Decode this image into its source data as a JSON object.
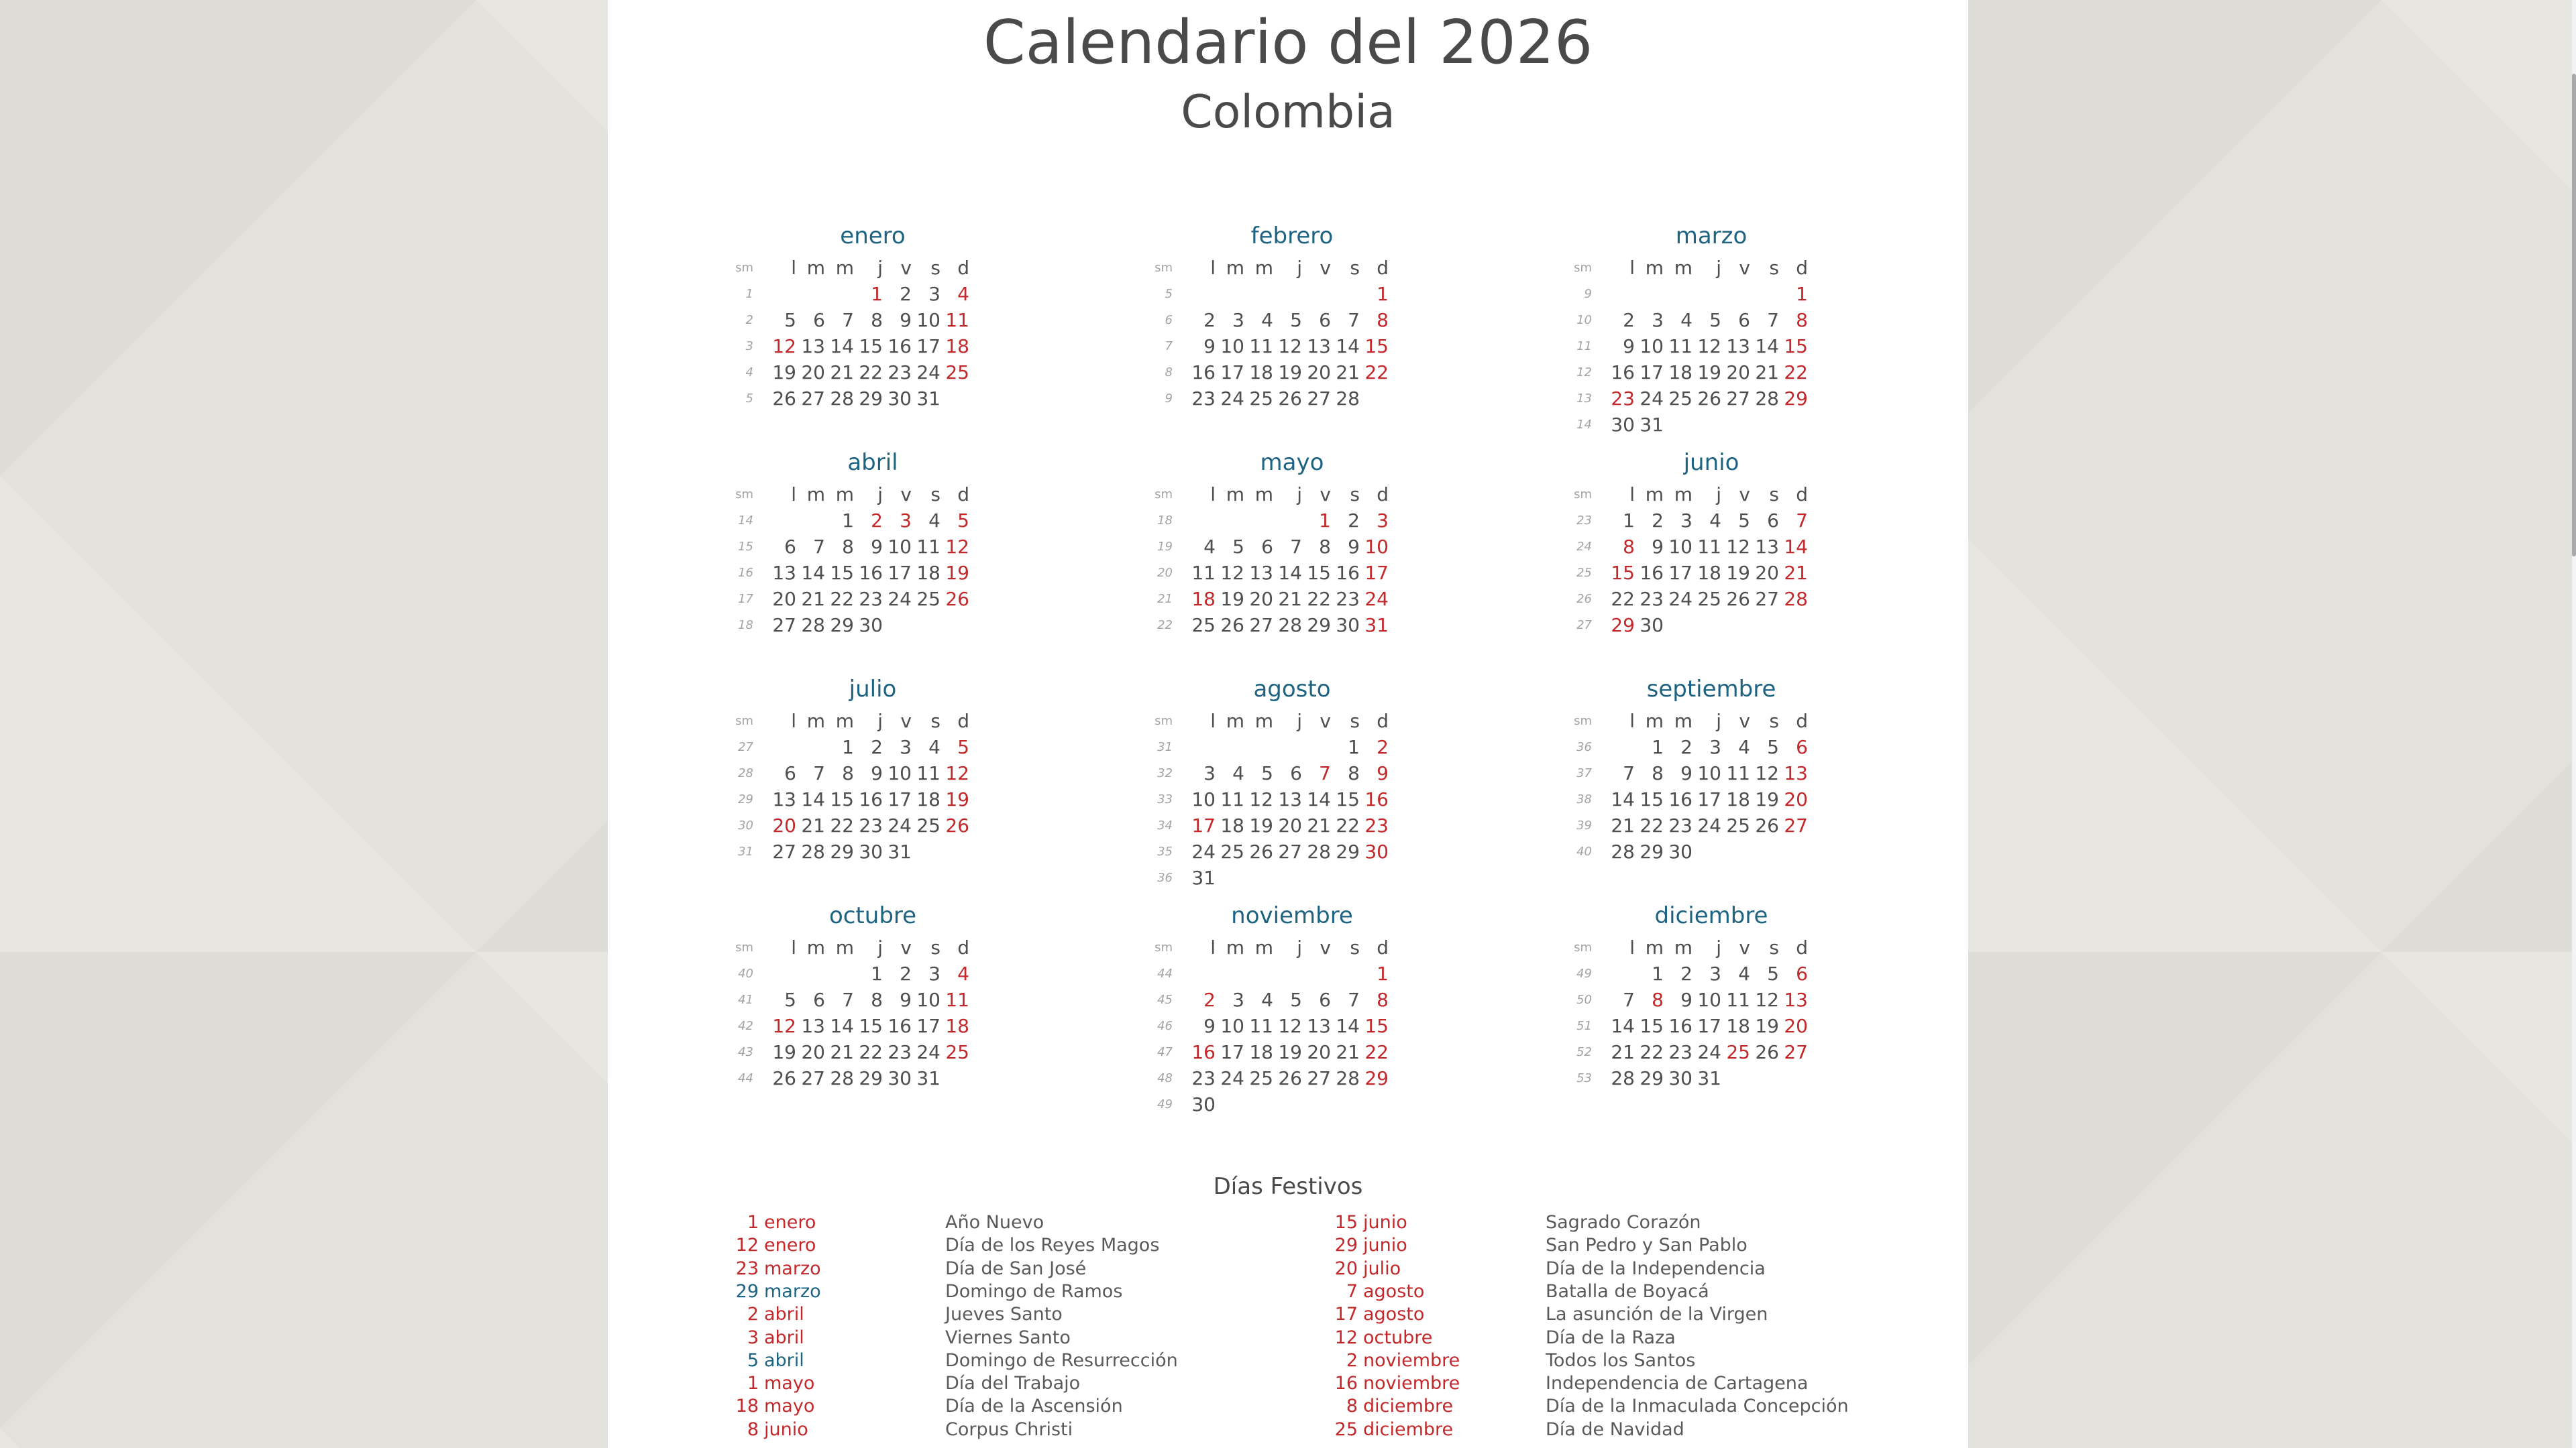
{
  "header": {
    "title": "Calendario del 2026",
    "subtitle": "Colombia"
  },
  "calendar": {
    "week_header": "sm",
    "weekday_headers": [
      "l",
      "m",
      "m",
      "j",
      "v",
      "s",
      "d"
    ],
    "months": [
      {
        "name": "enero",
        "weeks": [
          {
            "wk": "1",
            "days": [
              "",
              "",
              "",
              "1",
              "2",
              "3",
              "4"
            ]
          },
          {
            "wk": "2",
            "days": [
              "5",
              "6",
              "7",
              "8",
              "9",
              "10",
              "11"
            ]
          },
          {
            "wk": "3",
            "days": [
              "12",
              "13",
              "14",
              "15",
              "16",
              "17",
              "18"
            ]
          },
          {
            "wk": "4",
            "days": [
              "19",
              "20",
              "21",
              "22",
              "23",
              "24",
              "25"
            ]
          },
          {
            "wk": "5",
            "days": [
              "26",
              "27",
              "28",
              "29",
              "30",
              "31",
              ""
            ]
          }
        ],
        "holidays": [
          "1",
          "12"
        ]
      },
      {
        "name": "febrero",
        "weeks": [
          {
            "wk": "5",
            "days": [
              "",
              "",
              "",
              "",
              "",
              "",
              "1"
            ]
          },
          {
            "wk": "6",
            "days": [
              "2",
              "3",
              "4",
              "5",
              "6",
              "7",
              "8"
            ]
          },
          {
            "wk": "7",
            "days": [
              "9",
              "10",
              "11",
              "12",
              "13",
              "14",
              "15"
            ]
          },
          {
            "wk": "8",
            "days": [
              "16",
              "17",
              "18",
              "19",
              "20",
              "21",
              "22"
            ]
          },
          {
            "wk": "9",
            "days": [
              "23",
              "24",
              "25",
              "26",
              "27",
              "28",
              ""
            ]
          }
        ],
        "holidays": []
      },
      {
        "name": "marzo",
        "weeks": [
          {
            "wk": "9",
            "days": [
              "",
              "",
              "",
              "",
              "",
              "",
              "1"
            ]
          },
          {
            "wk": "10",
            "days": [
              "2",
              "3",
              "4",
              "5",
              "6",
              "7",
              "8"
            ]
          },
          {
            "wk": "11",
            "days": [
              "9",
              "10",
              "11",
              "12",
              "13",
              "14",
              "15"
            ]
          },
          {
            "wk": "12",
            "days": [
              "16",
              "17",
              "18",
              "19",
              "20",
              "21",
              "22"
            ]
          },
          {
            "wk": "13",
            "days": [
              "23",
              "24",
              "25",
              "26",
              "27",
              "28",
              "29"
            ]
          },
          {
            "wk": "14",
            "days": [
              "30",
              "31",
              "",
              "",
              "",
              "",
              ""
            ]
          }
        ],
        "holidays": [
          "23"
        ]
      },
      {
        "name": "abril",
        "weeks": [
          {
            "wk": "14",
            "days": [
              "",
              "",
              "1",
              "2",
              "3",
              "4",
              "5"
            ]
          },
          {
            "wk": "15",
            "days": [
              "6",
              "7",
              "8",
              "9",
              "10",
              "11",
              "12"
            ]
          },
          {
            "wk": "16",
            "days": [
              "13",
              "14",
              "15",
              "16",
              "17",
              "18",
              "19"
            ]
          },
          {
            "wk": "17",
            "days": [
              "20",
              "21",
              "22",
              "23",
              "24",
              "25",
              "26"
            ]
          },
          {
            "wk": "18",
            "days": [
              "27",
              "28",
              "29",
              "30",
              "",
              "",
              ""
            ]
          }
        ],
        "holidays": [
          "2",
          "3"
        ]
      },
      {
        "name": "mayo",
        "weeks": [
          {
            "wk": "18",
            "days": [
              "",
              "",
              "",
              "",
              "1",
              "2",
              "3"
            ]
          },
          {
            "wk": "19",
            "days": [
              "4",
              "5",
              "6",
              "7",
              "8",
              "9",
              "10"
            ]
          },
          {
            "wk": "20",
            "days": [
              "11",
              "12",
              "13",
              "14",
              "15",
              "16",
              "17"
            ]
          },
          {
            "wk": "21",
            "days": [
              "18",
              "19",
              "20",
              "21",
              "22",
              "23",
              "24"
            ]
          },
          {
            "wk": "22",
            "days": [
              "25",
              "26",
              "27",
              "28",
              "29",
              "30",
              "31"
            ]
          }
        ],
        "holidays": [
          "1",
          "18"
        ]
      },
      {
        "name": "junio",
        "weeks": [
          {
            "wk": "23",
            "days": [
              "1",
              "2",
              "3",
              "4",
              "5",
              "6",
              "7"
            ]
          },
          {
            "wk": "24",
            "days": [
              "8",
              "9",
              "10",
              "11",
              "12",
              "13",
              "14"
            ]
          },
          {
            "wk": "25",
            "days": [
              "15",
              "16",
              "17",
              "18",
              "19",
              "20",
              "21"
            ]
          },
          {
            "wk": "26",
            "days": [
              "22",
              "23",
              "24",
              "25",
              "26",
              "27",
              "28"
            ]
          },
          {
            "wk": "27",
            "days": [
              "29",
              "30",
              "",
              "",
              "",
              "",
              ""
            ]
          }
        ],
        "holidays": [
          "8",
          "15",
          "29"
        ]
      },
      {
        "name": "julio",
        "weeks": [
          {
            "wk": "27",
            "days": [
              "",
              "",
              "1",
              "2",
              "3",
              "4",
              "5"
            ]
          },
          {
            "wk": "28",
            "days": [
              "6",
              "7",
              "8",
              "9",
              "10",
              "11",
              "12"
            ]
          },
          {
            "wk": "29",
            "days": [
              "13",
              "14",
              "15",
              "16",
              "17",
              "18",
              "19"
            ]
          },
          {
            "wk": "30",
            "days": [
              "20",
              "21",
              "22",
              "23",
              "24",
              "25",
              "26"
            ]
          },
          {
            "wk": "31",
            "days": [
              "27",
              "28",
              "29",
              "30",
              "31",
              "",
              ""
            ]
          }
        ],
        "holidays": [
          "20"
        ]
      },
      {
        "name": "agosto",
        "weeks": [
          {
            "wk": "31",
            "days": [
              "",
              "",
              "",
              "",
              "",
              "1",
              "2"
            ]
          },
          {
            "wk": "32",
            "days": [
              "3",
              "4",
              "5",
              "6",
              "7",
              "8",
              "9"
            ]
          },
          {
            "wk": "33",
            "days": [
              "10",
              "11",
              "12",
              "13",
              "14",
              "15",
              "16"
            ]
          },
          {
            "wk": "34",
            "days": [
              "17",
              "18",
              "19",
              "20",
              "21",
              "22",
              "23"
            ]
          },
          {
            "wk": "35",
            "days": [
              "24",
              "25",
              "26",
              "27",
              "28",
              "29",
              "30"
            ]
          },
          {
            "wk": "36",
            "days": [
              "31",
              "",
              "",
              "",
              "",
              "",
              ""
            ]
          }
        ],
        "holidays": [
          "7",
          "17"
        ]
      },
      {
        "name": "septiembre",
        "weeks": [
          {
            "wk": "36",
            "days": [
              "",
              "1",
              "2",
              "3",
              "4",
              "5",
              "6"
            ]
          },
          {
            "wk": "37",
            "days": [
              "7",
              "8",
              "9",
              "10",
              "11",
              "12",
              "13"
            ]
          },
          {
            "wk": "38",
            "days": [
              "14",
              "15",
              "16",
              "17",
              "18",
              "19",
              "20"
            ]
          },
          {
            "wk": "39",
            "days": [
              "21",
              "22",
              "23",
              "24",
              "25",
              "26",
              "27"
            ]
          },
          {
            "wk": "40",
            "days": [
              "28",
              "29",
              "30",
              "",
              "",
              "",
              ""
            ]
          }
        ],
        "holidays": []
      },
      {
        "name": "octubre",
        "weeks": [
          {
            "wk": "40",
            "days": [
              "",
              "",
              "",
              "1",
              "2",
              "3",
              "4"
            ]
          },
          {
            "wk": "41",
            "days": [
              "5",
              "6",
              "7",
              "8",
              "9",
              "10",
              "11"
            ]
          },
          {
            "wk": "42",
            "days": [
              "12",
              "13",
              "14",
              "15",
              "16",
              "17",
              "18"
            ]
          },
          {
            "wk": "43",
            "days": [
              "19",
              "20",
              "21",
              "22",
              "23",
              "24",
              "25"
            ]
          },
          {
            "wk": "44",
            "days": [
              "26",
              "27",
              "28",
              "29",
              "30",
              "31",
              ""
            ]
          }
        ],
        "holidays": [
          "12"
        ]
      },
      {
        "name": "noviembre",
        "weeks": [
          {
            "wk": "44",
            "days": [
              "",
              "",
              "",
              "",
              "",
              "",
              "1"
            ]
          },
          {
            "wk": "45",
            "days": [
              "2",
              "3",
              "4",
              "5",
              "6",
              "7",
              "8"
            ]
          },
          {
            "wk": "46",
            "days": [
              "9",
              "10",
              "11",
              "12",
              "13",
              "14",
              "15"
            ]
          },
          {
            "wk": "47",
            "days": [
              "16",
              "17",
              "18",
              "19",
              "20",
              "21",
              "22"
            ]
          },
          {
            "wk": "48",
            "days": [
              "23",
              "24",
              "25",
              "26",
              "27",
              "28",
              "29"
            ]
          },
          {
            "wk": "49",
            "days": [
              "30",
              "",
              "",
              "",
              "",
              "",
              ""
            ]
          }
        ],
        "holidays": [
          "2",
          "16"
        ]
      },
      {
        "name": "diciembre",
        "weeks": [
          {
            "wk": "49",
            "days": [
              "",
              "1",
              "2",
              "3",
              "4",
              "5",
              "6"
            ]
          },
          {
            "wk": "50",
            "days": [
              "7",
              "8",
              "9",
              "10",
              "11",
              "12",
              "13"
            ]
          },
          {
            "wk": "51",
            "days": [
              "14",
              "15",
              "16",
              "17",
              "18",
              "19",
              "20"
            ]
          },
          {
            "wk": "52",
            "days": [
              "21",
              "22",
              "23",
              "24",
              "25",
              "26",
              "27"
            ]
          },
          {
            "wk": "53",
            "days": [
              "28",
              "29",
              "30",
              "31",
              "",
              "",
              ""
            ]
          }
        ],
        "holidays": [
          "8",
          "25"
        ]
      }
    ]
  },
  "holidays_section": {
    "title": "Días Festivos",
    "left": [
      {
        "day": "1",
        "month": "enero",
        "name": "Año Nuevo",
        "color": "red"
      },
      {
        "day": "12",
        "month": "enero",
        "name": "Día de los Reyes Magos",
        "color": "red"
      },
      {
        "day": "23",
        "month": "marzo",
        "name": "Día de San José",
        "color": "red"
      },
      {
        "day": "29",
        "month": "marzo",
        "name": "Domingo de Ramos",
        "color": "blue"
      },
      {
        "day": "2",
        "month": "abril",
        "name": "Jueves Santo",
        "color": "red"
      },
      {
        "day": "3",
        "month": "abril",
        "name": "Viernes Santo",
        "color": "red"
      },
      {
        "day": "5",
        "month": "abril",
        "name": "Domingo de Resurrección",
        "color": "blue"
      },
      {
        "day": "1",
        "month": "mayo",
        "name": "Día del Trabajo",
        "color": "red"
      },
      {
        "day": "18",
        "month": "mayo",
        "name": "Día de la Ascensión",
        "color": "red"
      },
      {
        "day": "8",
        "month": "junio",
        "name": "Corpus Christi",
        "color": "red"
      }
    ],
    "right": [
      {
        "day": "15",
        "month": "junio",
        "name": "Sagrado Corazón",
        "color": "red"
      },
      {
        "day": "29",
        "month": "junio",
        "name": "San Pedro y San Pablo",
        "color": "red"
      },
      {
        "day": "20",
        "month": "julio",
        "name": "Día de la Independencia",
        "color": "red"
      },
      {
        "day": "7",
        "month": "agosto",
        "name": "Batalla de Boyacá",
        "color": "red"
      },
      {
        "day": "17",
        "month": "agosto",
        "name": "La asunción de la Virgen",
        "color": "red"
      },
      {
        "day": "12",
        "month": "octubre",
        "name": "Día de la Raza",
        "color": "red"
      },
      {
        "day": "2",
        "month": "noviembre",
        "name": "Todos los Santos",
        "color": "red"
      },
      {
        "day": "16",
        "month": "noviembre",
        "name": "Independencia de Cartagena",
        "color": "red"
      },
      {
        "day": "8",
        "month": "diciembre",
        "name": "Día de la Inmaculada Concepción",
        "color": "red"
      },
      {
        "day": "25",
        "month": "diciembre",
        "name": "Día de Navidad",
        "color": "red"
      }
    ]
  },
  "colors": {
    "holiday": "#c3292b",
    "month_name": "#1e6482",
    "text": "#4f4f4f",
    "week_number": "#a3a3a3"
  }
}
